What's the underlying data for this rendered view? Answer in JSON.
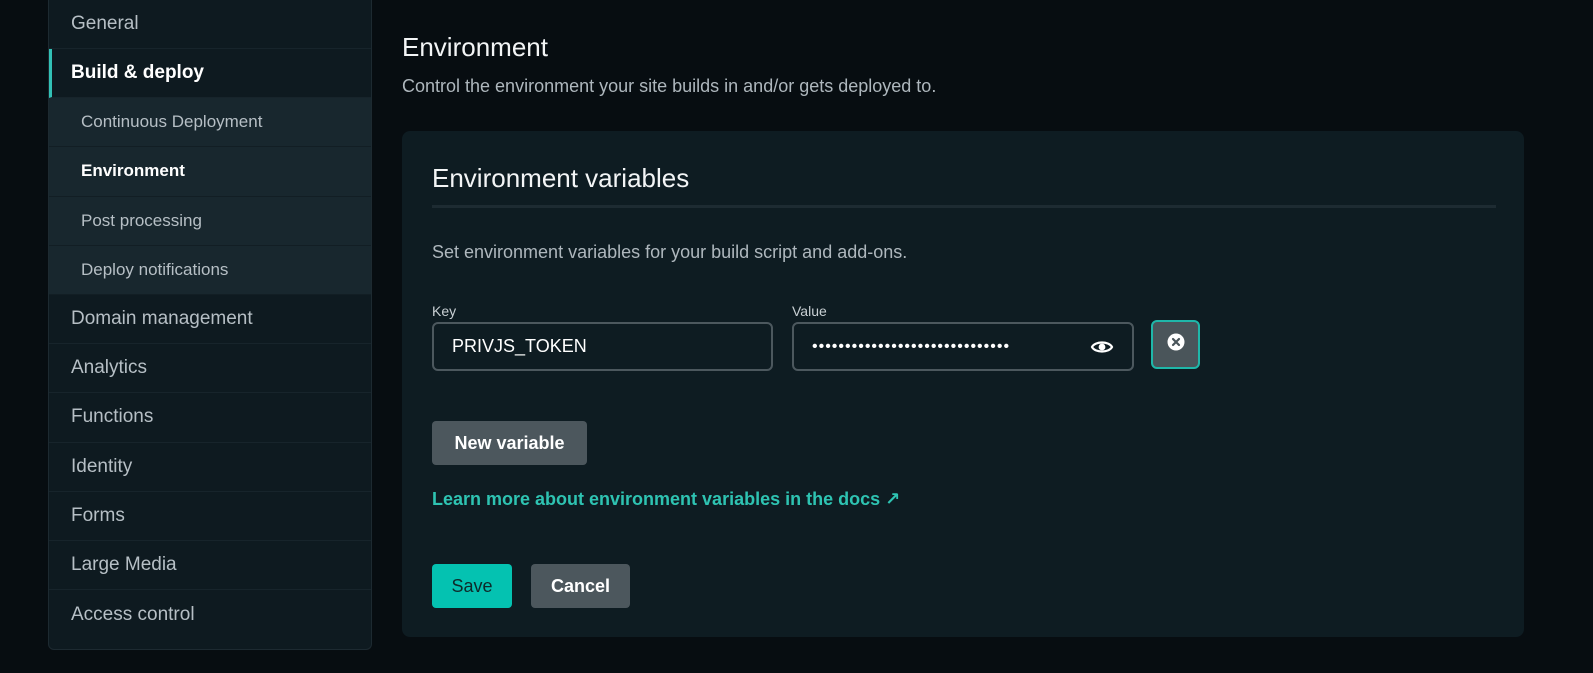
{
  "sidebar": {
    "items_top": [
      {
        "label": "General"
      },
      {
        "label": "Build & deploy"
      }
    ],
    "subitems": [
      {
        "label": "Continuous Deployment"
      },
      {
        "label": "Environment"
      },
      {
        "label": "Post processing"
      },
      {
        "label": "Deploy notifications"
      }
    ],
    "items_bottom": [
      {
        "label": "Domain management"
      },
      {
        "label": "Analytics"
      },
      {
        "label": "Functions"
      },
      {
        "label": "Identity"
      },
      {
        "label": "Forms"
      },
      {
        "label": "Large Media"
      },
      {
        "label": "Access control"
      }
    ]
  },
  "page": {
    "title": "Environment",
    "description": "Control the environment your site builds in and/or gets deployed to."
  },
  "card": {
    "title": "Environment variables",
    "description": "Set environment variables for your build script and add-ons.",
    "key_label": "Key",
    "value_label": "Value",
    "key_value": "PRIVJS_TOKEN",
    "value_masked": "••••••••••••••••••••••••••••••",
    "new_variable_label": "New variable",
    "docs_link_label": "Learn more about environment variables in the docs ↗",
    "save_label": "Save",
    "cancel_label": "Cancel"
  },
  "colors": {
    "accent": "#04c2b1",
    "link": "#2ec3b2",
    "background": "#070d11",
    "card": "#0e1c22"
  }
}
